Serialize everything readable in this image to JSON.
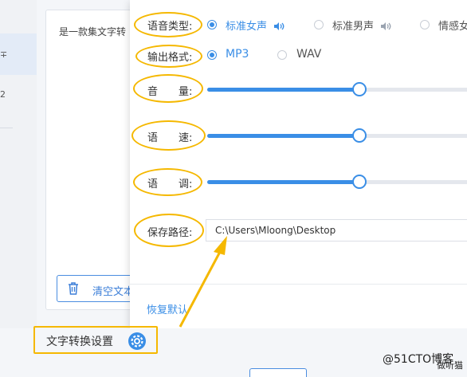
{
  "sidebar": {
    "frag_top": "∓",
    "frag_bottom": "2"
  },
  "text_panel": {
    "intro": "是一款集文字转",
    "clear_label": "清空文本"
  },
  "settings": {
    "voice_type": {
      "label": "语音类型:",
      "options": [
        "标准女声",
        "标准男声",
        "情感女"
      ],
      "selected": "标准女声"
    },
    "output_format": {
      "label": "输出格式:",
      "options": [
        "MP3",
        "WAV"
      ],
      "selected": "MP3"
    },
    "volume": {
      "label": "音　　量:",
      "value_percent": 55
    },
    "speed": {
      "label": "语　　速:",
      "value_percent": 55
    },
    "pitch": {
      "label": "语　　调:",
      "value_percent": 55
    },
    "save_path": {
      "label": "保存路径:",
      "value": "C:\\Users\\Mloong\\Desktop"
    },
    "restore_default": "恢复默认"
  },
  "footer": {
    "convert_settings_label": "文字转换设置"
  },
  "watermark": {
    "main": "@51CTO博客",
    "sub": "做听猫"
  },
  "colors": {
    "accent": "#3a8ee6",
    "annotation": "#f5b800"
  }
}
